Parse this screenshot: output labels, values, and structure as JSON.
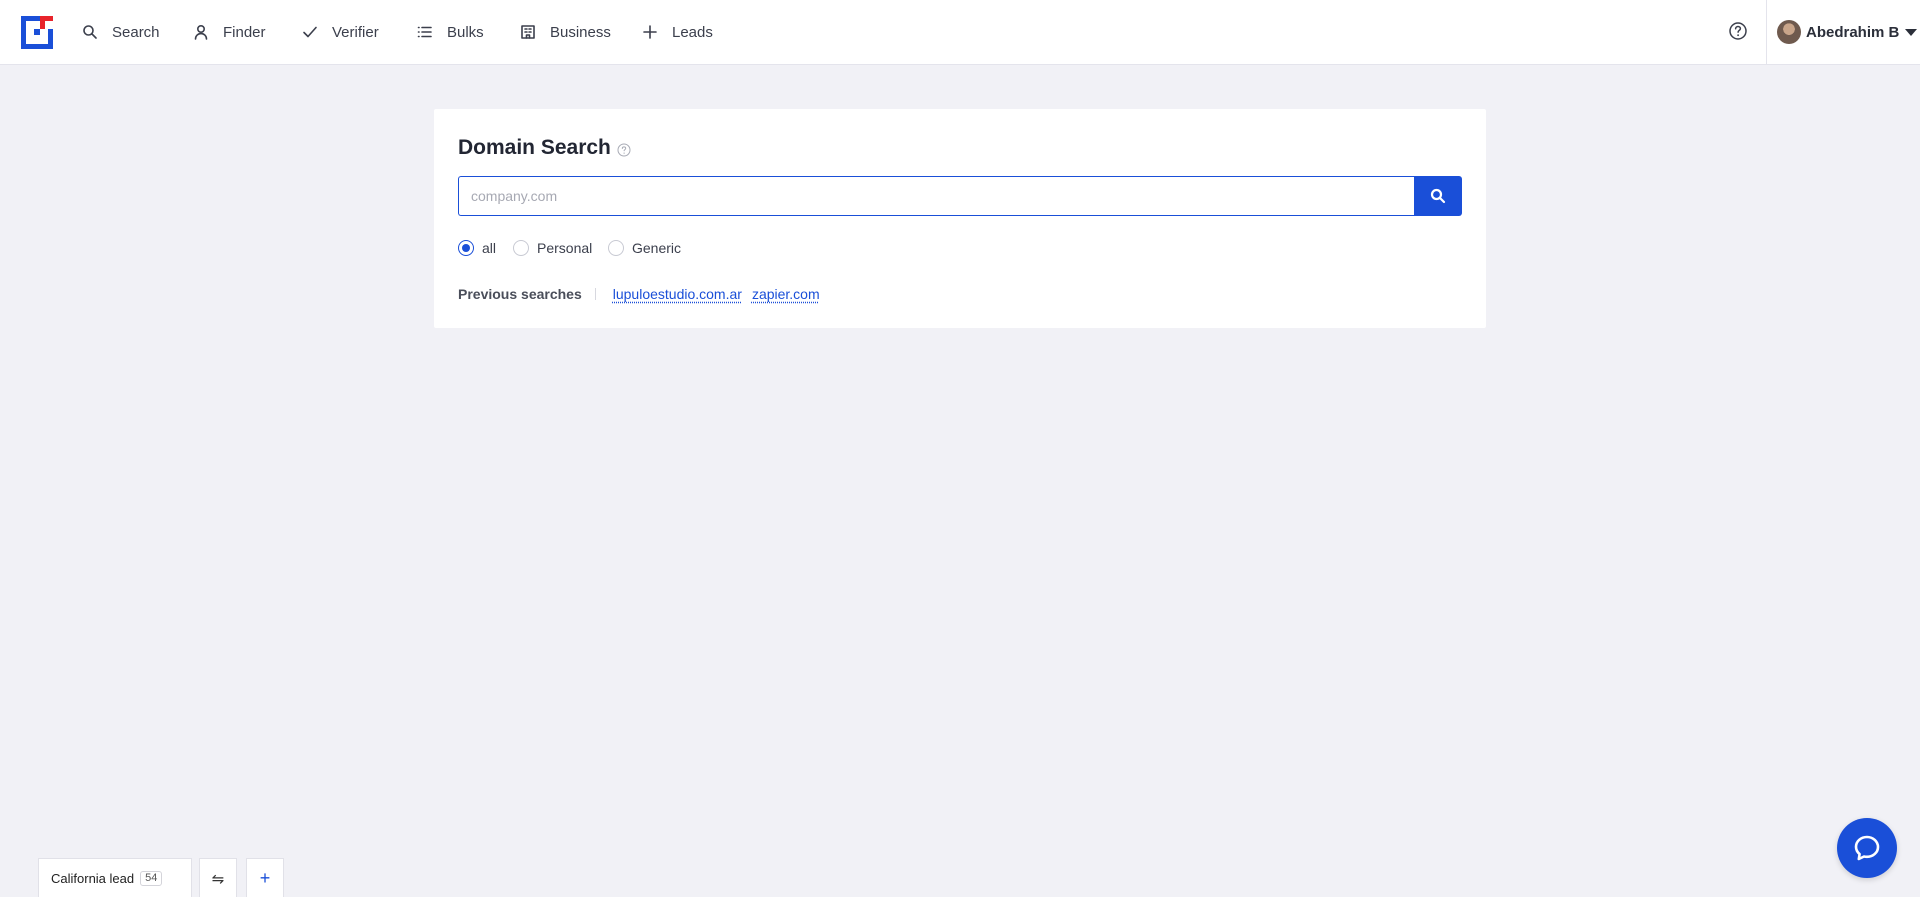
{
  "nav": {
    "items": [
      {
        "label": "Search",
        "icon": "search-icon"
      },
      {
        "label": "Finder",
        "icon": "user-icon"
      },
      {
        "label": "Verifier",
        "icon": "check-icon"
      },
      {
        "label": "Bulks",
        "icon": "list-icon"
      },
      {
        "label": "Business",
        "icon": "building-icon"
      },
      {
        "label": "Leads",
        "icon": "plus-icon"
      }
    ],
    "user_name": "Abedrahim B"
  },
  "domain_search": {
    "title": "Domain Search",
    "input_placeholder": "company.com",
    "input_value": "",
    "filters": [
      {
        "label": "all",
        "checked": true
      },
      {
        "label": "Personal",
        "checked": false
      },
      {
        "label": "Generic",
        "checked": false
      }
    ],
    "previous_label": "Previous searches",
    "previous": [
      "lupuloestudio.com.ar",
      "zapier.com"
    ]
  },
  "leads_tab": {
    "label": "California lead",
    "count": "54",
    "swap_icon": "⇋",
    "add_icon": "+"
  },
  "colors": {
    "accent": "#1a4fd8",
    "logo_red": "#e8242b",
    "background": "#f1f1f6"
  }
}
